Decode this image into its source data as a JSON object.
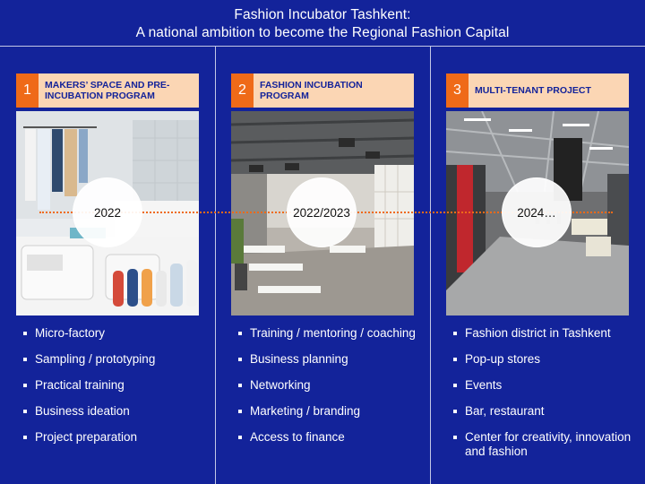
{
  "header": {
    "line1": "Fashion Incubator Tashkent:",
    "line2": "A national ambition to become the Regional Fashion Capital"
  },
  "columns": [
    {
      "number": "1",
      "title": "MAKERS’ SPACE AND PRE-INCUBATION PROGRAM",
      "year": "2022",
      "bullets": [
        "Micro-factory",
        "Sampling / prototyping",
        "Practical training",
        "Business ideation",
        "Project preparation"
      ]
    },
    {
      "number": "2",
      "title": "FASHION INCUBATION PROGRAM",
      "year": "2022/2023",
      "bullets": [
        "Training / mentoring / coaching",
        "Business planning",
        "Networking",
        "Marketing / branding",
        "Access to finance"
      ]
    },
    {
      "number": "3",
      "title": "MULTI-TENANT PROJECT",
      "year": "2024…",
      "bullets": [
        "Fashion district in Tashkent",
        "Pop-up stores",
        "Events",
        "Bar, restaurant",
        "Center for creativity, innovation and fashion"
      ]
    }
  ],
  "colors": {
    "background": "#13239a",
    "accent": "#ef6a18",
    "header_box": "#fbd6b4"
  }
}
